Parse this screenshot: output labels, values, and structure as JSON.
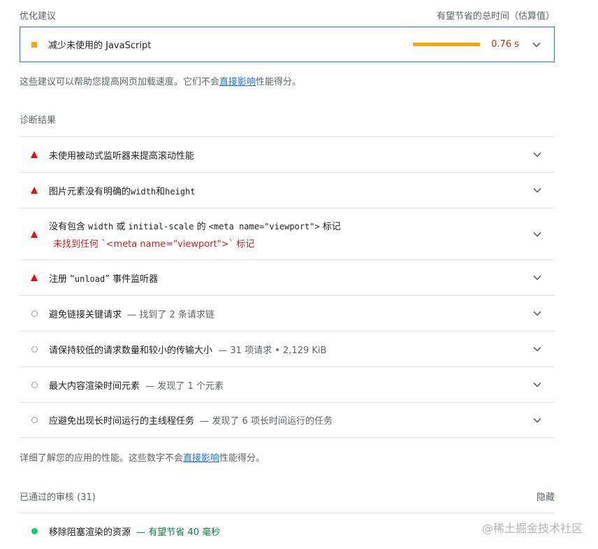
{
  "opportunities": {
    "heading": "优化建议",
    "savings_heading": "有望节省的总时间（估算值）",
    "item": {
      "title": "减少未使用的 JavaScript",
      "savings": "0.76 s"
    },
    "note_prefix": "这些建议可以帮助您提高网页加载速度。它们不会",
    "note_link": "直接影响",
    "note_suffix": "性能得分。"
  },
  "diagnostics": {
    "heading": "诊断结果",
    "items": [
      {
        "title": "未使用被动式监听器来提高滚动性能",
        "status": "fail"
      },
      {
        "title_prefix": "图片元素没有明确的",
        "code1": "width",
        "mid": "和",
        "code2": "height",
        "status": "fail"
      },
      {
        "title_prefix": "没有包含 ",
        "code1": "width",
        "mid": " 或 ",
        "code2": "initial-scale",
        "mid2": " 的 ",
        "code3": "<meta name=\"viewport\">",
        "suffix": " 标记",
        "error": "未找到任何 `<meta name=\"viewport\">` 标记",
        "status": "fail"
      },
      {
        "title_prefix": "注册 “",
        "code1": "unload",
        "suffix": "” 事件监听器",
        "status": "fail"
      },
      {
        "title": "避免链接关键请求",
        "display": "— 找到了 2 条请求链",
        "status": "info"
      },
      {
        "title": "请保持较低的请求数量和较小的传输大小",
        "display": "— 31 项请求 • 2,129 KiB",
        "status": "info"
      },
      {
        "title": "最大内容渲染时间元素",
        "display": "— 发现了 1 个元素",
        "status": "info"
      },
      {
        "title": "应避免出现长时间运行的主线程任务",
        "display": "— 发现了 6 项长时间运行的任务",
        "status": "info"
      }
    ],
    "note_prefix": "详细了解您的应用的性能。这些数字不会",
    "note_link": "直接影响",
    "note_suffix": "性能得分。"
  },
  "passed": {
    "heading": "已通过的审核",
    "count": "(31)",
    "hide_label": "隐藏",
    "item": {
      "title": "移除阻塞渲染的资源",
      "display": "— 有望节省 40 毫秒"
    }
  },
  "watermark": "@稀土掘金技术社区",
  "colors": {
    "accent": "#1a73e8",
    "warn": "#ffa400",
    "fail": "#eb0f00",
    "pass": "#0cce6b"
  }
}
